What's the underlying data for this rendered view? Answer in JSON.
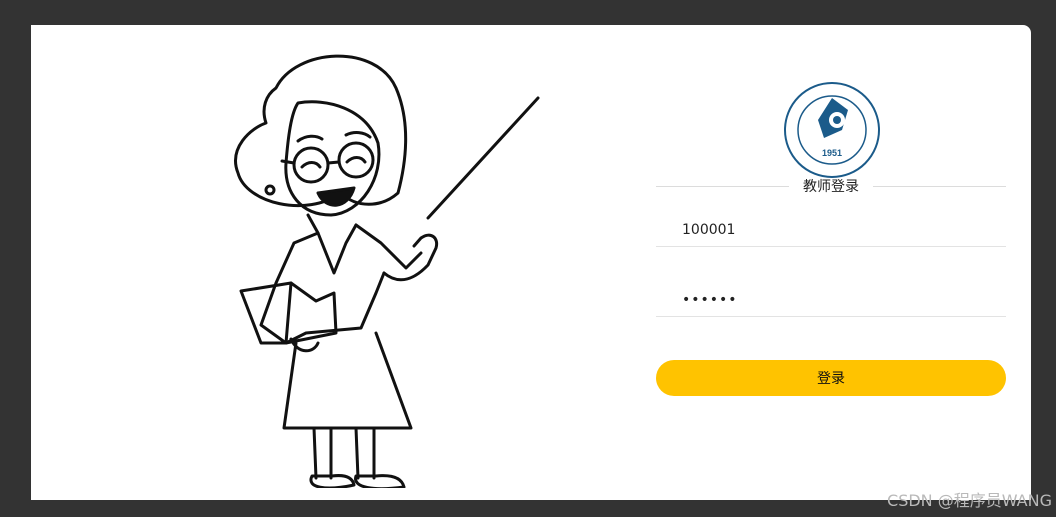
{
  "form": {
    "title": "教师登录",
    "username_value": "100001",
    "password_value": "123456",
    "login_label": "登录"
  },
  "logo": {
    "year": "1951",
    "ring_text": "INNER MONGOLIA UNIVERSITY OF TECHNOLOGY",
    "color": "#1b5b8a"
  },
  "theme": {
    "accent": "#ffc300",
    "background": "#333333",
    "card": "#ffffff"
  },
  "watermark": "CSDN @程序员WANG"
}
